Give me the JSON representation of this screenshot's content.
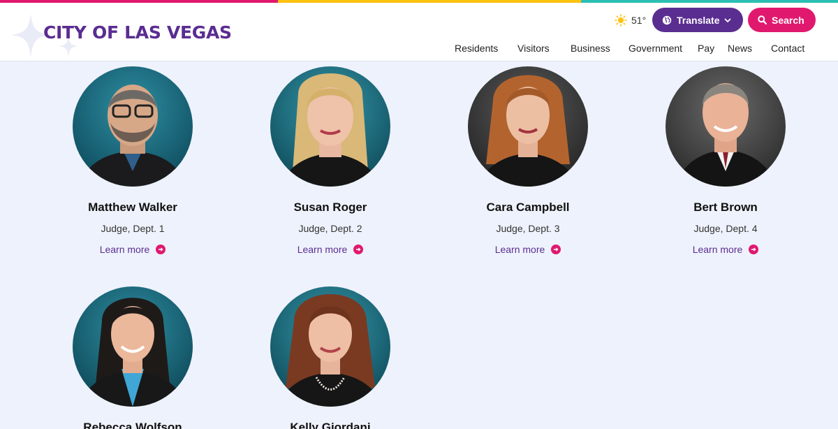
{
  "header": {
    "logo_text": "CITY OF LAS VEGAS",
    "weather": {
      "icon": "sun-icon",
      "temperature": "51°"
    },
    "translate_label": "Translate",
    "search_label": "Search",
    "nav": [
      "Residents",
      "Visitors",
      "Business",
      "Government",
      "Pay",
      "News",
      "Contact"
    ]
  },
  "colors": {
    "brand_purple": "#5a2d91",
    "brand_pink": "#e0196f",
    "brand_yellow": "#ffc20e",
    "brand_teal": "#2bbfb3",
    "page_bg": "#eef2fc"
  },
  "judges": [
    {
      "name": "Matthew Walker",
      "title": "Judge, Dept. 1",
      "link": "Learn more"
    },
    {
      "name": "Susan Roger",
      "title": "Judge, Dept. 2",
      "link": "Learn more"
    },
    {
      "name": "Cara Campbell",
      "title": "Judge, Dept. 3",
      "link": "Learn more"
    },
    {
      "name": "Bert Brown",
      "title": "Judge, Dept. 4",
      "link": "Learn more"
    },
    {
      "name": "Rebecca Wolfson",
      "title": "",
      "link": ""
    },
    {
      "name": "Kelly Giordani",
      "title": "",
      "link": ""
    }
  ]
}
